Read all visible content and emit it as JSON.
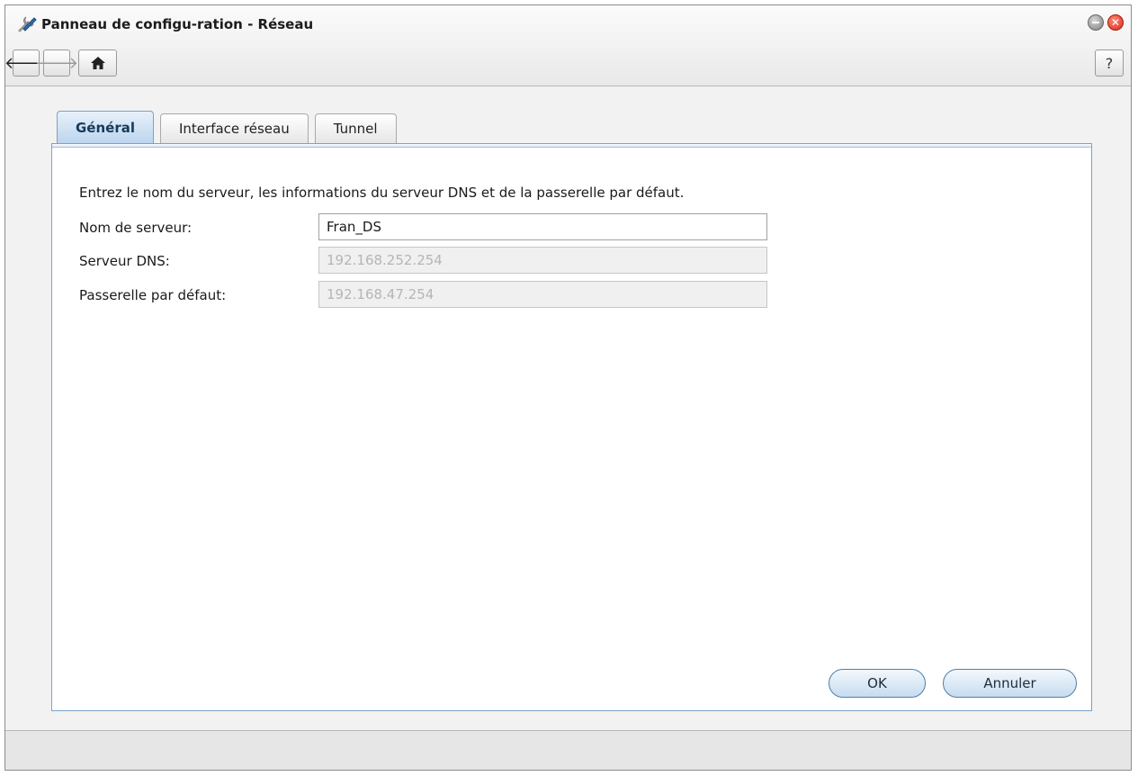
{
  "window": {
    "title": "Panneau de configu-ration - Réseau",
    "app_icon": "tools-icon",
    "controls": [
      "minimize-icon",
      "close-icon"
    ]
  },
  "toolbar": {
    "back_icon": "arrow-left-icon",
    "forward_icon": "arrow-right-icon",
    "home_icon": "home-icon",
    "help_label": "?"
  },
  "tabs": [
    {
      "label": "Général",
      "active": true
    },
    {
      "label": "Interface réseau",
      "active": false
    },
    {
      "label": "Tunnel",
      "active": false
    }
  ],
  "form": {
    "intro": "Entrez le nom du serveur, les informations du serveur DNS et de la passerelle par défaut.",
    "server_name": {
      "label": "Nom de serveur:",
      "value": "Fran_DS"
    },
    "dns_server": {
      "label": "Serveur DNS:",
      "value": "192.168.252.254"
    },
    "gateway": {
      "label": "Passerelle par défaut:",
      "value": "192.168.47.254"
    }
  },
  "buttons": {
    "ok": "OK",
    "cancel": "Annuler"
  },
  "colors": {
    "accent": "#7aa2c8",
    "close": "#d62a1a"
  }
}
